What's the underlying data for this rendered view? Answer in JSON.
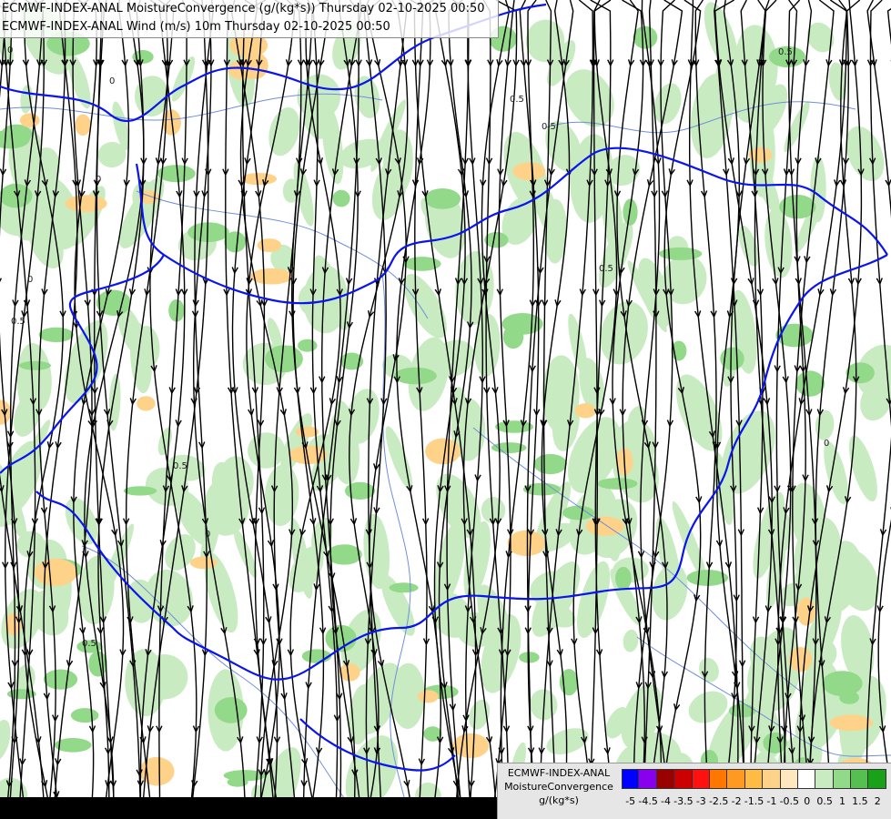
{
  "titles": {
    "line1": "ECMWF-INDEX-ANAL MoistureConvergence (g/(kg*s)) Thursday 02-10-2025 00:50",
    "line2": "ECMWF-INDEX-ANAL Wind (m/s) 10m Thursday 02-10-2025 00:50"
  },
  "legend": {
    "model": "ECMWF-INDEX-ANAL",
    "parameter": "MoistureConvergence",
    "unit": "g/(kg*s)",
    "tick_labels": [
      "-5",
      "-4.5",
      "-4",
      "-3.5",
      "-3",
      "-2.5",
      "-2",
      "-1.5",
      "-1",
      "-0.5",
      "0",
      "0.5",
      "1",
      "1.5",
      "2"
    ],
    "colors": [
      "#0000ff",
      "#8800ee",
      "#990000",
      "#cc0000",
      "#ff1111",
      "#ff7700",
      "#ff9922",
      "#ffbb44",
      "#ffd28a",
      "#ffe8bf",
      "#ffffff",
      "#c8ebc2",
      "#93d98a",
      "#55bf4f",
      "#1aa11a"
    ]
  },
  "contour_labels": [
    "0",
    "0",
    "0",
    "0",
    "0.5",
    "0.5",
    "0.5",
    "0.5",
    "0.5",
    "0.5",
    "0",
    "0",
    "0.5"
  ],
  "colors": {
    "border": "#0a14ee",
    "streamline": "#000000",
    "river": "#6f8fd9",
    "positive": "#c8ebc2",
    "positive_strong": "#93d98a",
    "negative": "#ffd28a"
  }
}
